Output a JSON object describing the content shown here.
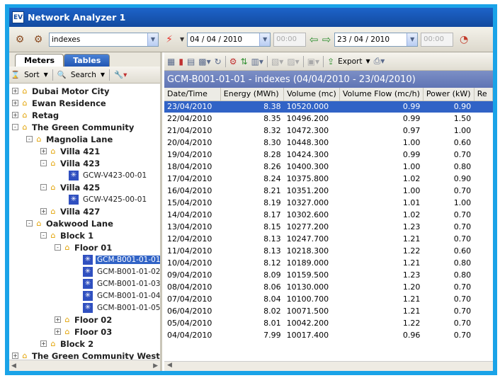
{
  "window": {
    "title": "Network Analyzer 1",
    "icon_letter": "EV"
  },
  "toolbar": {
    "search_value": "indexes",
    "date_from": "04 / 04 / 2010",
    "time_from": "00:00",
    "date_to": "23 / 04 / 2010",
    "time_to": "00:00"
  },
  "left_tabs": {
    "meters": "Meters",
    "tables": "Tables"
  },
  "left_toolbar": {
    "sort": "Sort",
    "search": "Search"
  },
  "tree": [
    {
      "label": "Dubai Motor City",
      "level": 0,
      "kind": "group",
      "exp": "+"
    },
    {
      "label": "Ewan Residence",
      "level": 0,
      "kind": "group",
      "exp": "+"
    },
    {
      "label": "Retag",
      "level": 0,
      "kind": "group",
      "exp": "+"
    },
    {
      "label": "The Green Community",
      "level": 0,
      "kind": "group",
      "exp": "-"
    },
    {
      "label": "Magnolia Lane",
      "level": 1,
      "kind": "group",
      "exp": "-"
    },
    {
      "label": "Villa 421",
      "level": 2,
      "kind": "group",
      "exp": "+"
    },
    {
      "label": "Villa 423",
      "level": 2,
      "kind": "group",
      "exp": "-"
    },
    {
      "label": "GCW-V423-00-01",
      "level": 3,
      "kind": "meter"
    },
    {
      "label": "Villa 425",
      "level": 2,
      "kind": "group",
      "exp": "-"
    },
    {
      "label": "GCW-V425-00-01",
      "level": 3,
      "kind": "meter"
    },
    {
      "label": "Villa 427",
      "level": 2,
      "kind": "group",
      "exp": "+"
    },
    {
      "label": "Oakwood Lane",
      "level": 1,
      "kind": "group",
      "exp": "-"
    },
    {
      "label": "Block 1",
      "level": 2,
      "kind": "group",
      "exp": "-"
    },
    {
      "label": "Floor 01",
      "level": 3,
      "kind": "group",
      "exp": "-"
    },
    {
      "label": "GCM-B001-01-01",
      "level": 4,
      "kind": "meter",
      "selected": true
    },
    {
      "label": "GCM-B001-01-02",
      "level": 4,
      "kind": "meter"
    },
    {
      "label": "GCM-B001-01-03",
      "level": 4,
      "kind": "meter"
    },
    {
      "label": "GCM-B001-01-04",
      "level": 4,
      "kind": "meter"
    },
    {
      "label": "GCM-B001-01-05",
      "level": 4,
      "kind": "meter"
    },
    {
      "label": "Floor 02",
      "level": 3,
      "kind": "group",
      "exp": "+"
    },
    {
      "label": "Floor 03",
      "level": 3,
      "kind": "group",
      "exp": "+"
    },
    {
      "label": "Block 2",
      "level": 2,
      "kind": "group",
      "exp": "+"
    },
    {
      "label": "The Green Community West",
      "level": 0,
      "kind": "group",
      "exp": "+"
    }
  ],
  "right_toolbar": {
    "export": "Export"
  },
  "grid": {
    "title": "GCM-B001-01-01 - indexes (04/04/2010 - 23/04/2010)",
    "columns": [
      "Date/Time",
      "Energy (MWh)",
      "Volume (mc)",
      "Volume Flow (mc/h)",
      "Power (kW)",
      "Re"
    ],
    "rows": [
      [
        "23/04/2010",
        "8.38",
        "10520.000",
        "0.99",
        "0.90"
      ],
      [
        "22/04/2010",
        "8.35",
        "10496.200",
        "0.99",
        "1.50"
      ],
      [
        "21/04/2010",
        "8.32",
        "10472.300",
        "0.97",
        "1.00"
      ],
      [
        "20/04/2010",
        "8.30",
        "10448.300",
        "1.00",
        "0.60"
      ],
      [
        "19/04/2010",
        "8.28",
        "10424.300",
        "0.99",
        "0.70"
      ],
      [
        "18/04/2010",
        "8.26",
        "10400.300",
        "1.00",
        "0.80"
      ],
      [
        "17/04/2010",
        "8.24",
        "10375.800",
        "1.02",
        "0.90"
      ],
      [
        "16/04/2010",
        "8.21",
        "10351.200",
        "1.00",
        "0.70"
      ],
      [
        "15/04/2010",
        "8.19",
        "10327.000",
        "1.01",
        "1.00"
      ],
      [
        "14/04/2010",
        "8.17",
        "10302.600",
        "1.02",
        "0.70"
      ],
      [
        "13/04/2010",
        "8.15",
        "10277.200",
        "1.23",
        "0.70"
      ],
      [
        "12/04/2010",
        "8.13",
        "10247.700",
        "1.21",
        "0.70"
      ],
      [
        "11/04/2010",
        "8.13",
        "10218.300",
        "1.22",
        "0.60"
      ],
      [
        "10/04/2010",
        "8.12",
        "10189.000",
        "1.21",
        "0.80"
      ],
      [
        "09/04/2010",
        "8.09",
        "10159.500",
        "1.23",
        "0.80"
      ],
      [
        "08/04/2010",
        "8.06",
        "10130.000",
        "1.20",
        "0.70"
      ],
      [
        "07/04/2010",
        "8.04",
        "10100.700",
        "1.21",
        "0.70"
      ],
      [
        "06/04/2010",
        "8.02",
        "10071.500",
        "1.21",
        "0.70"
      ],
      [
        "05/04/2010",
        "8.01",
        "10042.200",
        "1.22",
        "0.70"
      ],
      [
        "04/04/2010",
        "7.99",
        "10017.400",
        "0.96",
        "0.70"
      ]
    ]
  }
}
